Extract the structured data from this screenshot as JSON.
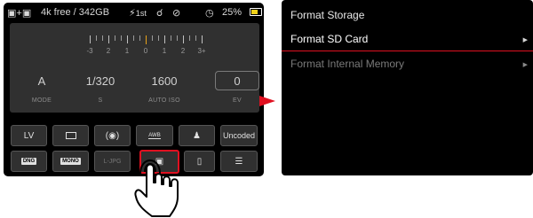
{
  "status_bar": {
    "mode_icon": "flash-storage-icon",
    "image_info": "4k free / 342GB",
    "flash_icon": "flash-icon",
    "flash_text": "1st",
    "battery_percent": "25%",
    "battery_level": 0.25,
    "battery_color": "#f2d21a"
  },
  "exposure_scale": {
    "labels": [
      "-3",
      "2",
      "1",
      "0",
      "1",
      "2",
      "3+"
    ]
  },
  "parameters": [
    {
      "value": "A",
      "label": "MODE"
    },
    {
      "value": "1/320",
      "label": "S"
    },
    {
      "value": "1600",
      "label": "AUTO ISO"
    },
    {
      "value": "0",
      "label": "EV"
    }
  ],
  "function_buttons": {
    "row1": [
      "LV",
      "frame-icon",
      "metering-icon",
      "AWB",
      "person-icon",
      "Uncoded"
    ],
    "row2": [
      "DNG",
      "MONO",
      "L-JPG",
      "storage-icon",
      "smartphone-icon",
      "menu-icon"
    ]
  },
  "menu": {
    "title": "Format Storage",
    "items": [
      {
        "label": "Format SD Card"
      },
      {
        "label": "Format Internal Memory"
      }
    ],
    "accent_color": "#e01020"
  }
}
